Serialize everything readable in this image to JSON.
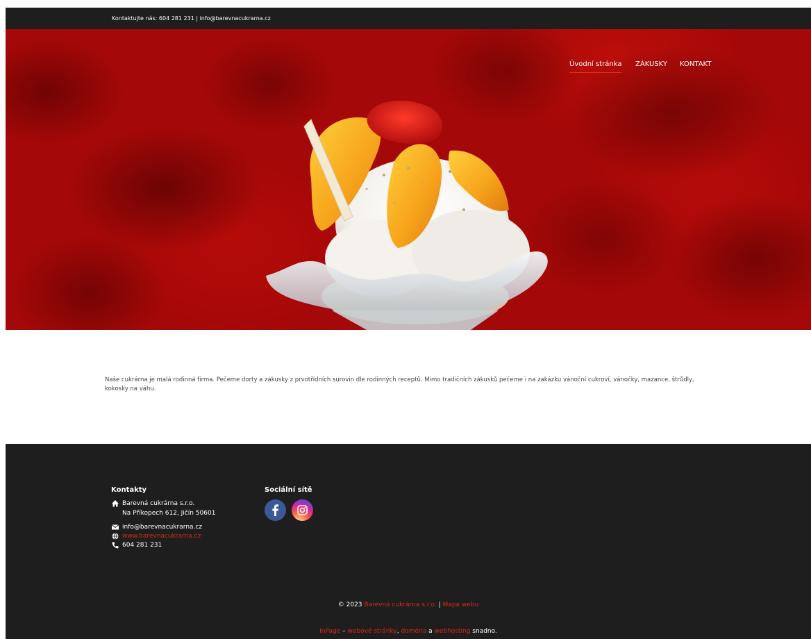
{
  "topbar": {
    "contact_text": "Kontaktujte nás: 604 281 231 | info@barevnacukrarna.cz"
  },
  "nav": {
    "items": [
      {
        "label": "Úvodní stránka",
        "active": true
      },
      {
        "label": "ZÁKUSKY",
        "active": false
      },
      {
        "label": "KONTAKT",
        "active": false
      }
    ]
  },
  "intro": {
    "text": "Naše cukrárna je malá rodinná firma. Pečeme dorty a zákusky z prvotřídních surovin dle rodinných receptů. Mimo tradičních zákusků pečeme i na zakázku vánoční cukroví, vánočky, mazance, štrůdly, kokosky na váhu."
  },
  "footer": {
    "contacts": {
      "title": "Kontakty",
      "company": "Barevná cukrárna s.r.o.",
      "address": "Na Příkopech 612, Jičín 50601",
      "email": "info@barevnacukrarna.cz",
      "website": "www.barevnacukrarna.cz",
      "phone": "604 281 231"
    },
    "social": {
      "title": "Sociální sítě",
      "icons": [
        "facebook-icon",
        "instagram-icon"
      ]
    },
    "copyright": {
      "prefix": "© 2023",
      "company_link": "Barevná cukrárna s.r.o.",
      "separator": "|",
      "sitemap_link": "Mapa webu"
    },
    "powered": {
      "brand_link": "InPage",
      "dash": " – ",
      "web_link": "webové stránky",
      "comma": ", ",
      "domain_link": "doména",
      "and": " a ",
      "hosting_link": "webhosting",
      "suffix": " snadno."
    }
  },
  "colors": {
    "dark": "#1e1e1e",
    "accent": "#d42a1c",
    "hero_red": "#a50808"
  }
}
